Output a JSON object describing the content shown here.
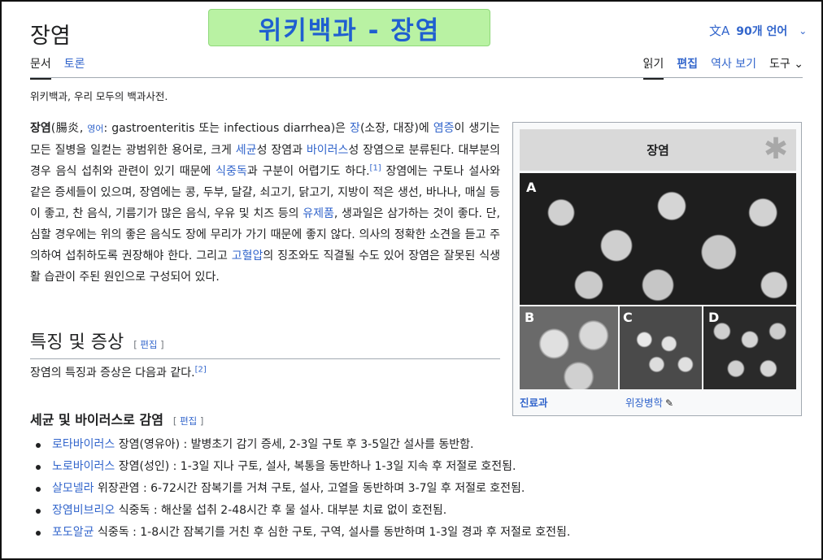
{
  "header": {
    "title": "장염",
    "banner": "위키백과 - 장염",
    "language_icon": "translate-icon",
    "language_label": "90개 언어"
  },
  "tabs_left": [
    {
      "label": "문서"
    },
    {
      "label": "토론"
    }
  ],
  "tabs_right": [
    {
      "label": "읽기"
    },
    {
      "label": "편집"
    },
    {
      "label": "역사 보기"
    },
    {
      "label": "도구"
    }
  ],
  "tagline": "위키백과, 우리 모두의 백과사전.",
  "intro": {
    "bold": "장염",
    "t1": "(腸炎, ",
    "lang": "영어",
    "t2": ": gastroenteritis 또는 infectious diarrhea)은 ",
    "link_jang": "장",
    "t3": "(소장, 대장)에 ",
    "link_yeomjeung": "염증",
    "t4": "이 생기는 모든 질병을 일컫는 광범위한 용어로, 크게 ",
    "link_segyun": "세균",
    "t5": "성 장염과 ",
    "link_virus": "바이러스",
    "t6": "성 장염으로 분류된다. 대부분의 경우 음식 섭취와 관련이 있기 때문에 ",
    "link_sikjungdok": "식중독",
    "t7": "과 구분이 어렵기도 하다.",
    "ref1": "[1]",
    "t8": " 장염에는 구토나 설사와 같은 증세들이 있으며, 장염에는 콩, 두부, 달걀, 쇠고기, 닭고기, 지방이 적은 생선, 바나나, 매실 등이 좋고, 찬 음식, 기름기가 많은 음식, 우유 및 치즈 등의 ",
    "link_yujepum": "유제품",
    "t9": ", 생과일은 삼가하는 것이 좋다. 단, 심할 경우에는 위의 좋은 음식도 장에 무리가 가기 때문에 좋지 않다. 의사의 정확한 소견을 듣고 주의하여 섭취하도록 권장해야 한다. 그리고 ",
    "link_gohyeolap": "고혈압",
    "t10": "의 징조와도 직결될 수도 있어 장염은 잘못된 식생활 습관이 주된 원인으로 구성되어 있다."
  },
  "section1": {
    "heading": "특징 및 증상",
    "edit_open": "[ ",
    "edit_label": "편집",
    "edit_close": " ]",
    "text": "장염의 특징과 증상은 다음과 같다.",
    "ref": "[2]"
  },
  "section2": {
    "heading": "세균 및 바이러스로 감염",
    "edit_open": "[ ",
    "edit_label": "편집",
    "edit_close": " ]",
    "items": [
      {
        "link": "로타바이러스",
        "text": " 장염(영유아) : 발병초기 감기 증세, 2-3일 구토 후 3-5일간 설사를 동반함."
      },
      {
        "link": "노로바이러스",
        "text": " 장염(성인) : 1-3일 지나 구토, 설사, 복통을 동반하나 1-3일 지속 후 저절로 호전됨."
      },
      {
        "link": "살모넬라",
        "text": " 위장관염 : 6-72시간 잠복기를 거쳐 구토, 설사, 고열을 동반하며 3-7일 후 저절로 호전됨."
      },
      {
        "link": "장염비브리오",
        "text": " 식중독 : 해산물 섭취 2-48시간 후 물 설사. 대부분 치료 없이 호전됨."
      },
      {
        "link": "포도알균",
        "text": " 식중독 : 1-8시간 잠복기를 거친 후 심한 구토, 구역, 설사를 동반하며 1-3일 경과 후 저절로 호전됨."
      }
    ]
  },
  "infobox": {
    "title": "장염",
    "logo_icon": "star-of-life-icon",
    "image_labels": [
      "A",
      "B",
      "C",
      "D"
    ],
    "row_key": "진료과",
    "row_value": "위장병학",
    "row_icon": "pencil-icon"
  }
}
